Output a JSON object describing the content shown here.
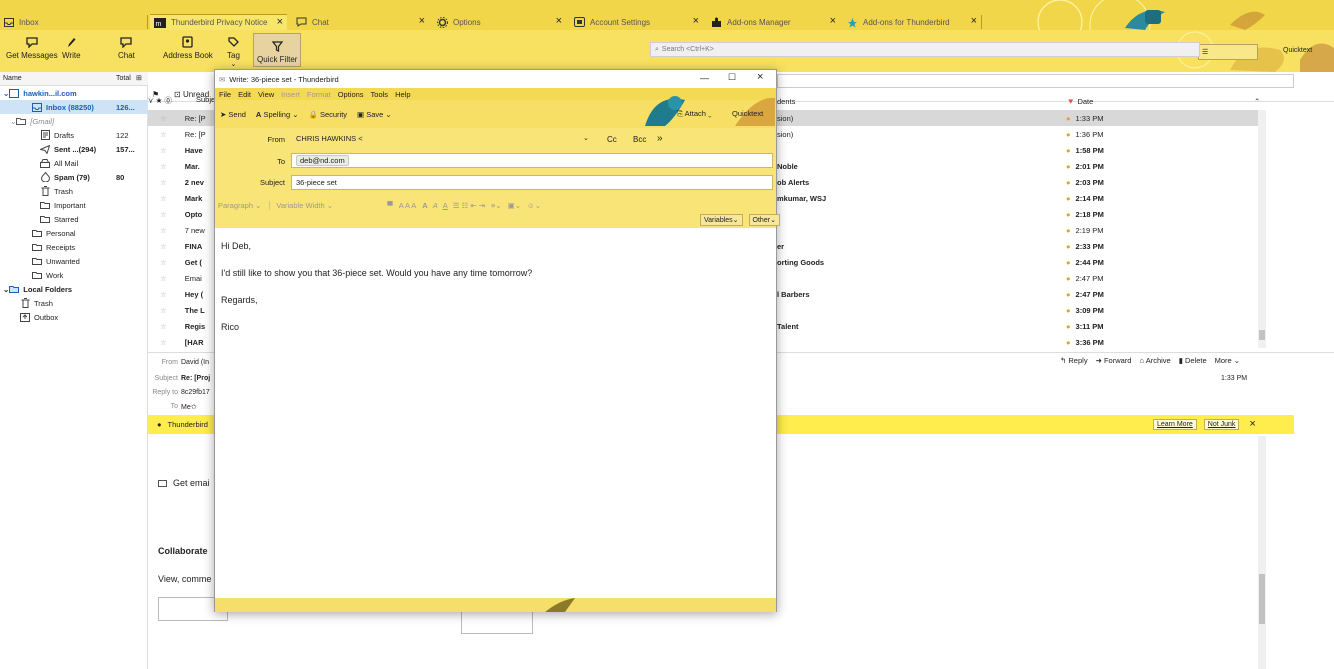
{
  "tabs": [
    {
      "label": "Inbox",
      "icon": "inbox-icon"
    },
    {
      "label": "Thunderbird Privacy Notice",
      "icon": "mozilla-icon"
    },
    {
      "label": "Chat",
      "icon": "chat-icon"
    },
    {
      "label": "Options",
      "icon": "gear-icon"
    },
    {
      "label": "Account Settings",
      "icon": "account-icon"
    },
    {
      "label": "Add-ons Manager",
      "icon": "puzzle-icon"
    },
    {
      "label": "Add-ons for Thunderbird",
      "icon": "addons-icon"
    }
  ],
  "toolbar": {
    "get_messages": "Get Messages",
    "write": "Write",
    "chat": "Chat",
    "address_book": "Address Book",
    "tag": "Tag",
    "quick_filter": "Quick Filter",
    "search_placeholder": "Search <Ctrl+K>",
    "quicktext": "Quicktext"
  },
  "folder_header": {
    "name": "Name",
    "total": "Total"
  },
  "folders": [
    {
      "label": "hawkin...il.com",
      "count": "",
      "icon": "account-icon"
    },
    {
      "label": "Inbox (88250)",
      "count": "126...",
      "icon": "inbox-icon"
    },
    {
      "label": "[Gmail]",
      "count": "",
      "icon": "folder-icon"
    },
    {
      "label": "Drafts",
      "count": "122",
      "icon": "drafts-icon"
    },
    {
      "label": "Sent ...(294)",
      "count": "157...",
      "icon": "sent-icon"
    },
    {
      "label": "All Mail",
      "count": "",
      "icon": "archive-icon"
    },
    {
      "label": "Spam (79)",
      "count": "80",
      "icon": "spam-icon"
    },
    {
      "label": "Trash",
      "count": "",
      "icon": "trash-icon"
    },
    {
      "label": "Important",
      "count": "",
      "icon": "folder-icon"
    },
    {
      "label": "Starred",
      "count": "",
      "icon": "folder-icon"
    },
    {
      "label": "Personal",
      "count": "",
      "icon": "folder-icon"
    },
    {
      "label": "Receipts",
      "count": "",
      "icon": "folder-icon"
    },
    {
      "label": "Unwanted",
      "count": "",
      "icon": "folder-icon"
    },
    {
      "label": "Work",
      "count": "",
      "icon": "folder-icon"
    },
    {
      "label": "Local Folders",
      "count": "",
      "icon": "folder-icon"
    },
    {
      "label": "Trash",
      "count": "",
      "icon": "trash-icon"
    },
    {
      "label": "Outbox",
      "count": "",
      "icon": "outbox-icon"
    }
  ],
  "thread_header": {
    "unread": "Unread",
    "subject": "Subje",
    "correspondents": "dents",
    "date": "Date"
  },
  "thread_subjects": [
    "Re: [P",
    "Re: [P",
    "Have",
    "Mar.",
    "2 nev",
    "Mark",
    "Opto",
    "7 new",
    "FINA",
    "Get (",
    "Emai",
    "Hey (",
    "The L",
    "Regis",
    "[HAR"
  ],
  "thread_correspondents": [
    "sion)",
    "sion)",
    "",
    "Noble",
    "ob Alerts",
    "mkumar, WSJ",
    "",
    "",
    "er",
    "orting Goods",
    "",
    "l Barbers",
    "",
    "Talent",
    ""
  ],
  "thread_dates": [
    "1:33 PM",
    "1:36 PM",
    "1:58 PM",
    "2:01 PM",
    "2:03 PM",
    "2:14 PM",
    "2:18 PM",
    "2:19 PM",
    "2:33 PM",
    "2:44 PM",
    "2:47 PM",
    "2:47 PM",
    "3:09 PM",
    "3:11 PM",
    "3:36 PM"
  ],
  "message_header": {
    "from_label": "From",
    "from_value": "David (In",
    "subject_label": "Subject",
    "subject_value": "Re: [Proj",
    "replyto_label": "Reply to",
    "replyto_value": "8c29fb17",
    "to_label": "To",
    "to_value": "Me",
    "time": "1:33 PM"
  },
  "message_actions": {
    "reply": "Reply",
    "forward": "Forward",
    "archive": "Archive",
    "delete": "Delete",
    "more": "More"
  },
  "notification": {
    "text": "Thunderbird",
    "learn_more": "Learn More",
    "not_junk": "Not Junk"
  },
  "preview_body": {
    "line1": "Get emai",
    "line2": "Collaborate",
    "line3": "View, comme"
  },
  "compose": {
    "title": "Write: 36-piece set - Thunderbird",
    "menu": [
      "File",
      "Edit",
      "View",
      "Insert",
      "Format",
      "Options",
      "Tools",
      "Help"
    ],
    "tools": {
      "send": "Send",
      "spelling": "Spelling",
      "security": "Security",
      "save": "Save",
      "attach": "Attach",
      "quicktext": "Quicktext"
    },
    "from_label": "From",
    "from_value": "CHRIS HAWKINS <",
    "cc": "Cc",
    "bcc": "Bcc",
    "to_label": "To",
    "to_value": "deb@nd.com",
    "subject_label": "Subject",
    "subject_value": "36-piece set",
    "paragraph": "Paragraph",
    "font": "Variable Width",
    "variables": "Variables",
    "other": "Other",
    "body": [
      "Hi Deb,",
      "I'd still like to show you that 36-piece set. Would you have any time tomorrow?",
      "Regards,",
      "Rico"
    ]
  }
}
